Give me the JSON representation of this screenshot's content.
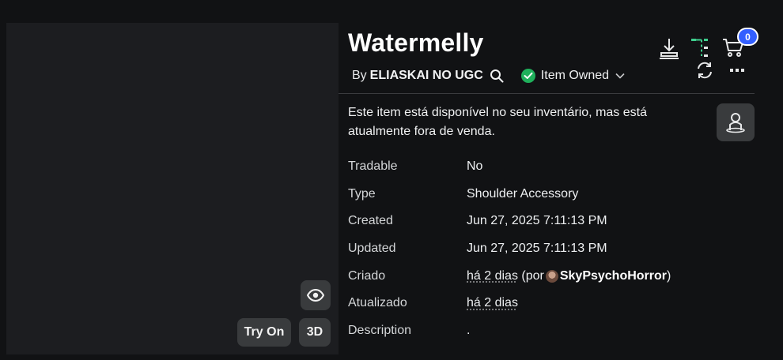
{
  "item": {
    "title": "Watermelly",
    "by_prefix": "By",
    "creator": "ELIASKAI NO UGC",
    "ownership_status": "Item Owned"
  },
  "viewer": {
    "try_on_label": "Try On",
    "three_d_label": "3D"
  },
  "header_actions": {
    "cart_count": "0",
    "icons": [
      "download-icon",
      "tree-icon",
      "cart-icon",
      "refresh-icon",
      "more-icon"
    ]
  },
  "notice": "Este item está disponível no seu inventário, mas está atualmente fora de venda.",
  "details": {
    "tradable": {
      "label": "Tradable",
      "value": "No"
    },
    "type": {
      "label": "Type",
      "value": "Shoulder Accessory"
    },
    "created": {
      "label": "Created",
      "value": "Jun 27, 2025 7:11:13 PM"
    },
    "updated": {
      "label": "Updated",
      "value": "Jun 27, 2025 7:11:13 PM"
    },
    "criado": {
      "label": "Criado",
      "time": "há 2 dias",
      "by_open": "(por",
      "user": "SkyPsychoHorror",
      "by_close": ")"
    },
    "atualizado": {
      "label": "Atualizado",
      "value": "há 2 dias"
    },
    "description": {
      "label": "Description",
      "value": "."
    }
  },
  "colors": {
    "background": "#111214",
    "panel": "#1c1d20",
    "button": "#393b3d",
    "owned_check": "#1fb05b",
    "badge": "#335fff",
    "tree_accent": "#3ecf8e"
  }
}
